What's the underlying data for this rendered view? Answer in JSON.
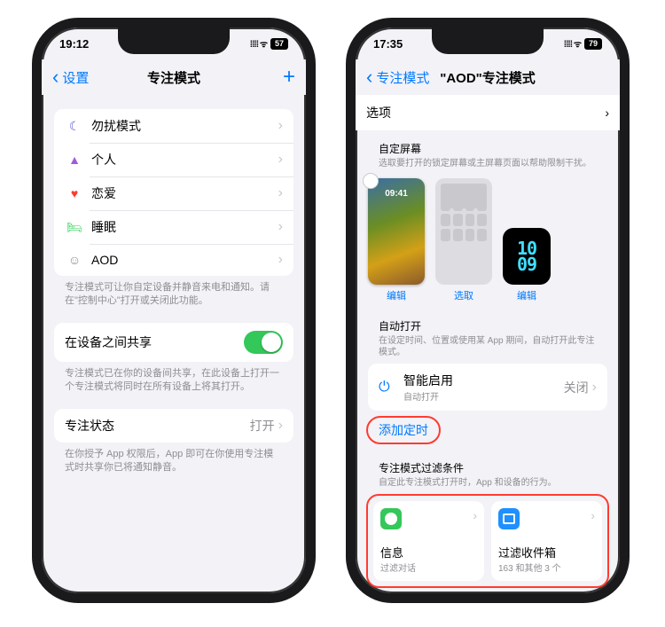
{
  "left": {
    "status": {
      "time": "19:12",
      "signal": "᎐᎐⁞⁞",
      "battery": "57"
    },
    "nav": {
      "back": "设置",
      "title": "专注模式",
      "add": "+"
    },
    "modes": [
      {
        "icon": "🌙",
        "color": "#5856d6",
        "label": "勿扰模式"
      },
      {
        "icon": "👤",
        "color": "#a259d9",
        "label": "个人"
      },
      {
        "icon": "❤︎",
        "color": "#ff3b30",
        "label": "恋爱"
      },
      {
        "icon": "🛏",
        "color": "#30d158",
        "label": "睡眠"
      },
      {
        "icon": "☺",
        "color": "#8e8e93",
        "label": "AOD"
      }
    ],
    "modes_footer": "专注模式可让你自定设备并静音来电和通知。请在\"控制中心\"打开或关闭此功能。",
    "share": {
      "label": "在设备之间共享",
      "footer": "专注模式已在你的设备间共享，在此设备上打开一个专注模式将同时在所有设备上将其打开。"
    },
    "status_row": {
      "label": "专注状态",
      "value": "打开",
      "footer": "在你授予 App 权限后，App 即可在你使用专注模式时共享你已将通知静音。"
    }
  },
  "right": {
    "status": {
      "time": "17:35",
      "battery": "79"
    },
    "nav": {
      "back": "专注模式",
      "title": "\"AOD\"专注模式"
    },
    "options_label": "选项",
    "screens": {
      "header": "自定屏幕",
      "desc": "选取要打开的锁定屏幕或主屏幕页面以帮助限制干扰。",
      "lock_caption": "编辑",
      "home_caption": "选取",
      "watch_caption": "编辑",
      "watch_time_top": "10",
      "watch_time_bottom": "09"
    },
    "auto": {
      "header": "自动打开",
      "desc": "在设定时间、位置或使用某 App 期间，自动打开此专注模式。",
      "smart_label": "智能启用",
      "smart_sub": "自动打开",
      "smart_value": "关闭",
      "add_timer": "添加定时"
    },
    "filters": {
      "header": "专注模式过滤条件",
      "desc": "自定此专注模式打开时，App 和设备的行为。",
      "card1_title": "信息",
      "card1_sub": "过滤对话",
      "card2_title": "过滤收件箱",
      "card2_sub": "163 和其他 3 个"
    }
  }
}
